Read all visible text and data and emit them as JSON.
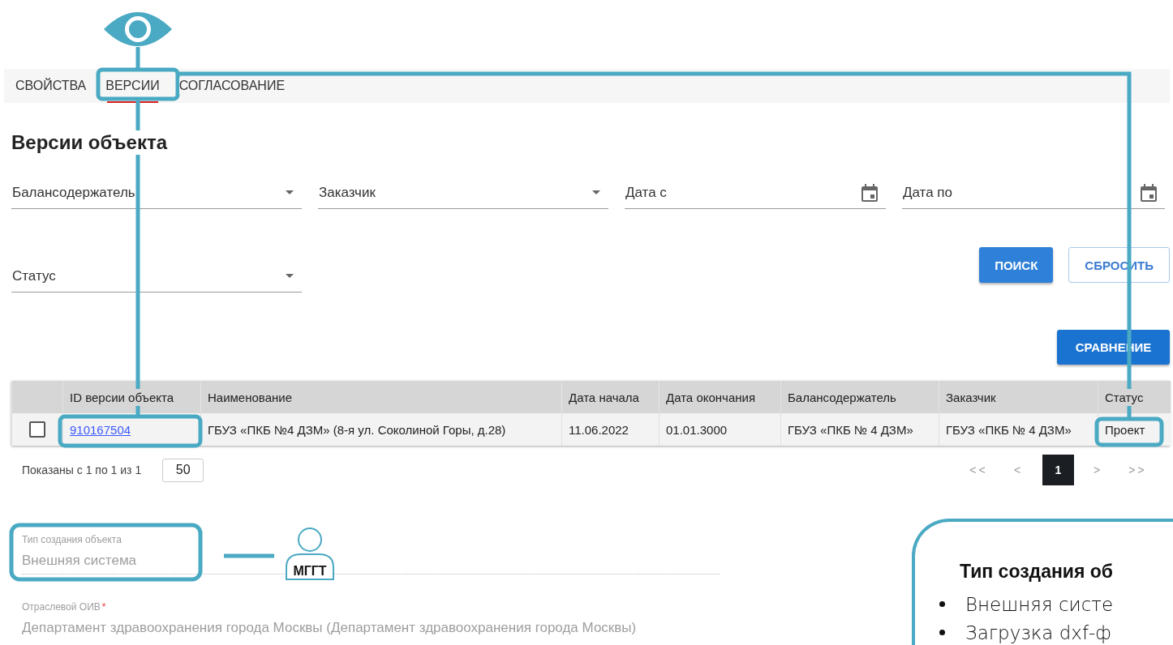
{
  "tabs": [
    {
      "label": "СВОЙСТВА",
      "selected": false
    },
    {
      "label": "ВЕРСИИ",
      "selected": true
    },
    {
      "label": "СОГЛАСОВАНИЕ",
      "selected": false
    }
  ],
  "heading": "Версии объекта",
  "filters": [
    {
      "kind": "select",
      "label": "Балансодержатель"
    },
    {
      "kind": "select",
      "label": "Заказчик"
    },
    {
      "kind": "date",
      "label": "Дата с"
    },
    {
      "kind": "date",
      "label": "Дата по"
    },
    {
      "kind": "select",
      "label": "Статус"
    }
  ],
  "filter_actions": [
    {
      "kind": "filled",
      "label": "ПОИСК"
    },
    {
      "kind": "outlined",
      "label": "СБРОСИТЬ"
    }
  ],
  "compare_button": {
    "label": "СРАВНЕНИЕ"
  },
  "table": {
    "columns": [
      {
        "kind": "check"
      },
      {
        "kind": "link",
        "label": "ID версии объекта"
      },
      {
        "kind": "text",
        "label": "Наименование"
      },
      {
        "kind": "text",
        "label": "Дата начала"
      },
      {
        "kind": "text",
        "label": "Дата окончания"
      },
      {
        "kind": "text",
        "label": "Балансодержатель"
      },
      {
        "kind": "text",
        "label": "Заказчик"
      },
      {
        "kind": "text",
        "label": "Статус"
      }
    ],
    "rows": [
      {
        "cells": [
          {
            "checked": false
          },
          "910167504",
          "ГБУЗ «ПКБ №4 ДЗМ» (8-я ул. Соколиной Горы, д.28)",
          "11.06.2022",
          "01.01.3000",
          "ГБУЗ «ПКБ № 4 ДЗМ»",
          "ГБУЗ «ПКБ № 4 ДЗМ»",
          "Проект"
        ]
      }
    ]
  },
  "pagination": {
    "summary": "Показаны с 1 по 1 из 1",
    "page_size": "50",
    "pages": [
      {
        "kind": "nav",
        "label": "<<",
        "selected": false
      },
      {
        "kind": "nav",
        "label": "<",
        "selected": false
      },
      {
        "kind": "page",
        "label": "1",
        "selected": true
      },
      {
        "kind": "nav",
        "label": ">",
        "selected": false
      },
      {
        "kind": "nav",
        "label": ">>",
        "selected": false
      }
    ]
  },
  "fields": [
    {
      "label": "Тип создания объекта",
      "value": "Внешняя система"
    },
    {
      "label": "Отраслевой ОИВ",
      "required_mark": "*",
      "value": "Департамент здравоохранения города Москвы (Департамент здравоохранения города Москвы)"
    }
  ],
  "annotations": {
    "badge_label": "МГГТ",
    "callout": {
      "title": "Тип создания об",
      "items": [
        "Внешняя систе",
        "Загрузка dxf-ф"
      ]
    }
  }
}
